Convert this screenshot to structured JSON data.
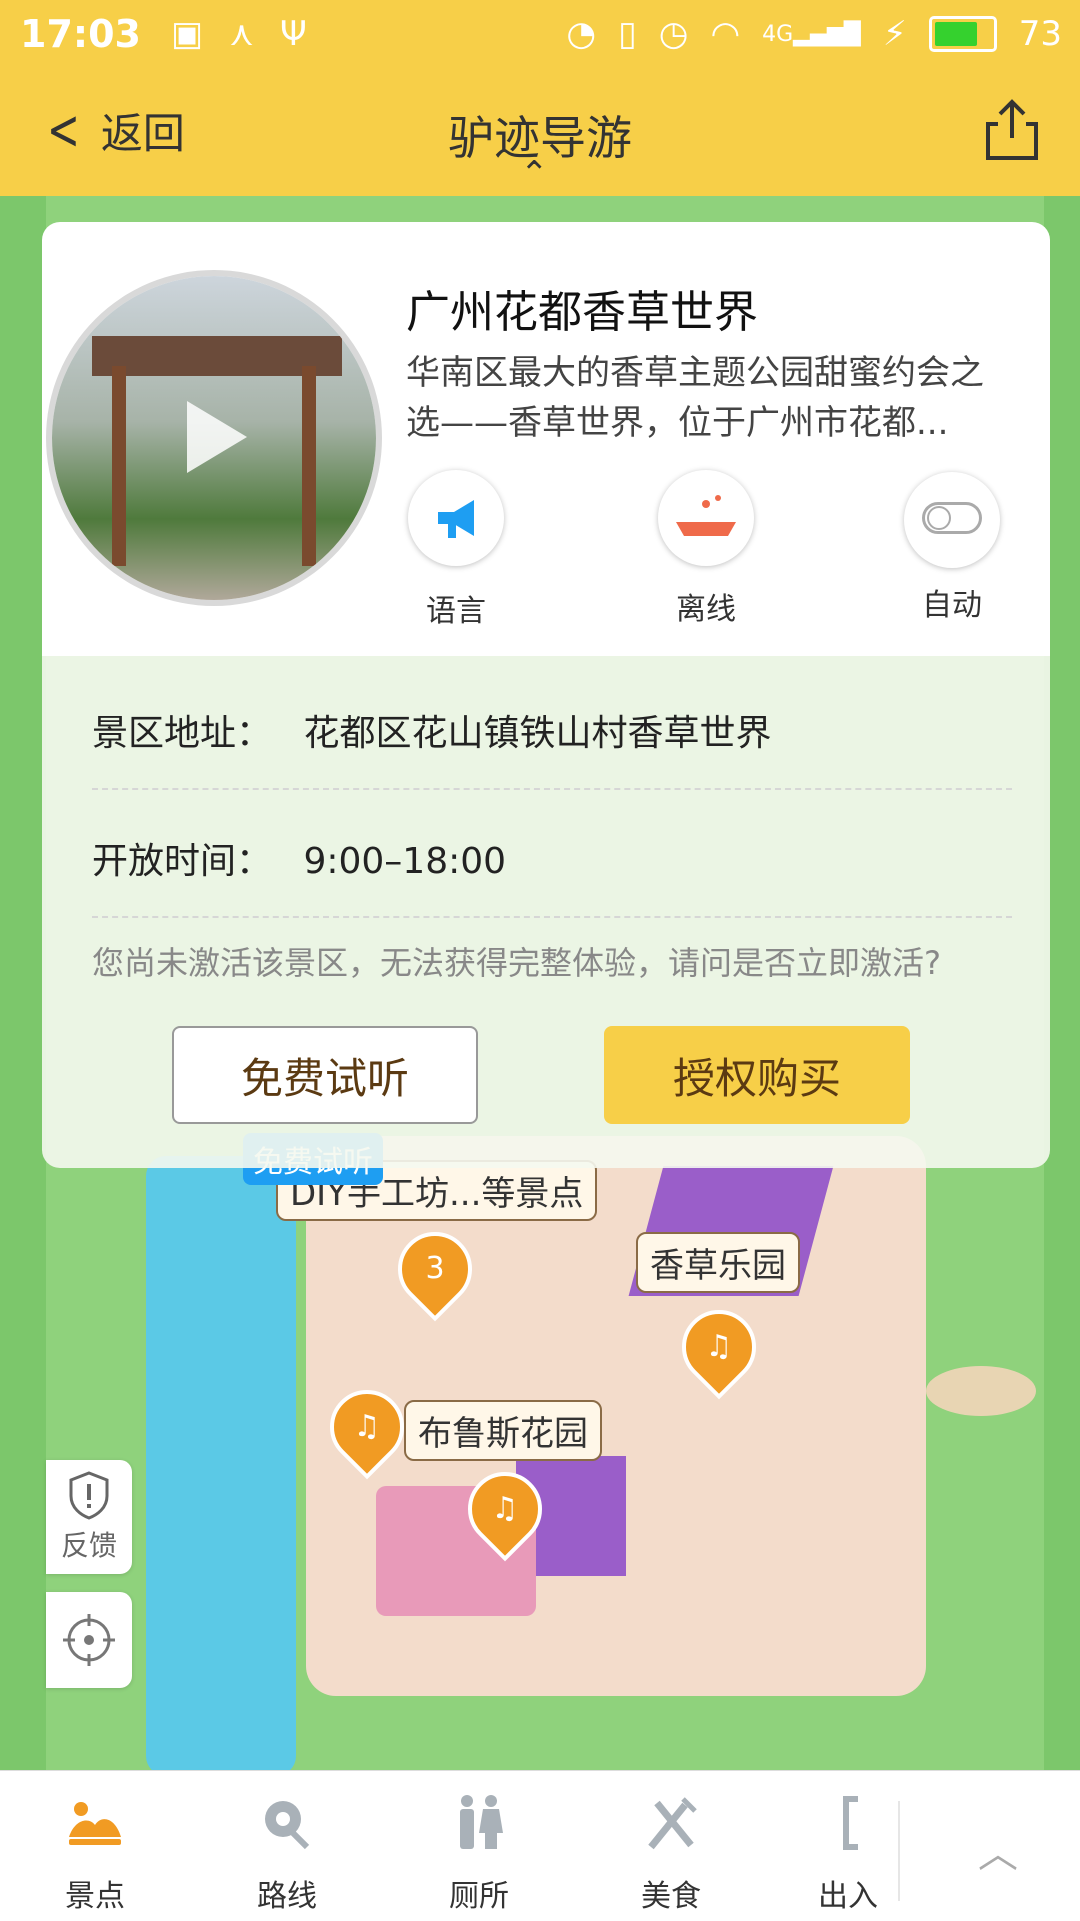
{
  "status_bar": {
    "time": "17:03",
    "battery": "73",
    "network": "4G",
    "left_icons": [
      "image-icon",
      "share-node-icon",
      "usb-icon"
    ],
    "right_icons": [
      "hotspot-icon",
      "vibrate-icon",
      "alarm-icon",
      "wifi-icon",
      "signal-icon",
      "charging-icon"
    ]
  },
  "header": {
    "back_label": "返回",
    "title": "驴迹导游",
    "share_icon": "share-icon"
  },
  "scenic": {
    "name": "广州花都香草世界",
    "description": "华南区最大的香草主题公园甜蜜约会之选——香草世界，位于广州市花都...",
    "controls": [
      {
        "label": "语言",
        "icon": "megaphone-icon"
      },
      {
        "label": "离线",
        "icon": "download-boat-icon"
      },
      {
        "label": "自动",
        "icon": "toggle-icon"
      }
    ],
    "address_label": "景区地址：",
    "address_value": "花都区花山镇铁山村香草世界",
    "hours_label": "开放时间：",
    "hours_value": "9:00–18:00",
    "notice": "您尚未激活该景区，无法获得完整体验，请问是否立即激活?",
    "free_button": "免费试听",
    "buy_button": "授权购买"
  },
  "map": {
    "labels": {
      "diy": "DIY手工坊...等景点",
      "vanilla_park": "香草乐园",
      "bruce_garden": "布鲁斯花园",
      "free_tag": "免费试听",
      "pin_3": "3"
    }
  },
  "side_buttons": {
    "feedback_label": "反馈"
  },
  "bottom_nav": {
    "items": [
      {
        "label": "景点",
        "icon": "scenic-spot-icon",
        "active": true
      },
      {
        "label": "路线",
        "icon": "route-icon",
        "active": false
      },
      {
        "label": "厕所",
        "icon": "toilet-icon",
        "active": false
      },
      {
        "label": "美食",
        "icon": "food-icon",
        "active": false
      },
      {
        "label": "出入",
        "icon": "exit-icon",
        "active": false
      }
    ],
    "accent": "#f19b23"
  }
}
